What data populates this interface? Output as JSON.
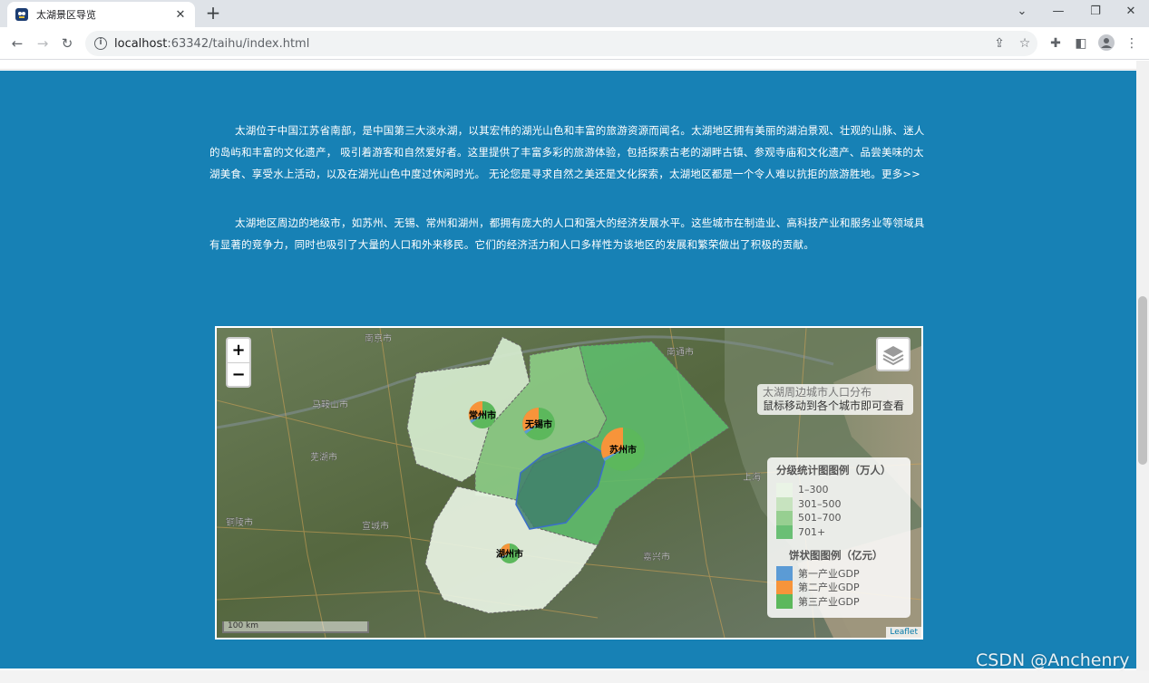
{
  "browser": {
    "tab_title": "太湖景区导览",
    "url_host": "localhost",
    "url_rest": ":63342/taihu/index.html"
  },
  "content": {
    "para1": "太湖位于中国江苏省南部，是中国第三大淡水湖，以其宏伟的湖光山色和丰富的旅游资源而闻名。太湖地区拥有美丽的湖泊景观、壮观的山脉、迷人的岛屿和丰富的文化遗产， 吸引着游客和自然爱好者。这里提供了丰富多彩的旅游体验，包括探索古老的湖畔古镇、参观寺庙和文化遗产、品尝美味的太湖美食、享受水上活动，以及在湖光山色中度过休闲时光。 无论您是寻求自然之美还是文化探索，太湖地区都是一个令人难以抗拒的旅游胜地。更多>>",
    "para2": "太湖地区周边的地级市，如苏州、无锡、常州和湖州，都拥有庞大的人口和强大的经济发展水平。这些城市在制造业、高科技产业和服务业等领域具有显著的竞争力，同时也吸引了大量的人口和外来移民。它们的经济活力和人口多样性为该地区的发展和繁荣做出了积极的贡献。"
  },
  "map": {
    "zoom_in": "+",
    "zoom_out": "−",
    "info_title": "太湖周边城市人口分布",
    "info_hint": "鼠标移动到各个城市即可查看",
    "legend_title": "分级统计图图例（万人）",
    "legend_classes": [
      {
        "label": "1–300",
        "color": "#eaf4e6"
      },
      {
        "label": "301–500",
        "color": "#c7e3bf"
      },
      {
        "label": "501–700",
        "color": "#97cf91"
      },
      {
        "label": "701+",
        "color": "#6abf75"
      }
    ],
    "pie_title": "饼状图图例（亿元）",
    "pie_classes": [
      {
        "label": "第一产业GDP",
        "color": "#5b9bd5"
      },
      {
        "label": "第二产业GDP",
        "color": "#f7943a"
      },
      {
        "label": "第三产业GDP",
        "color": "#5cb85c"
      }
    ],
    "cities": {
      "changzhou": "常州市",
      "wuxi": "无锡市",
      "suzhou": "苏州市",
      "huzhou": "湖州市"
    },
    "basemap_labels": {
      "nanjing": "南京市",
      "maanshan": "马鞍山市",
      "wuhu": "芜湖市",
      "tongling": "铜陵市",
      "xuancheng": "宣城市",
      "jiaxing": "嘉兴市",
      "nantong": "南通市",
      "shanghai": "上海"
    },
    "scale_label": "100 km",
    "attribution": "Leaflet"
  },
  "watermark": "CSDN @Anchenry"
}
